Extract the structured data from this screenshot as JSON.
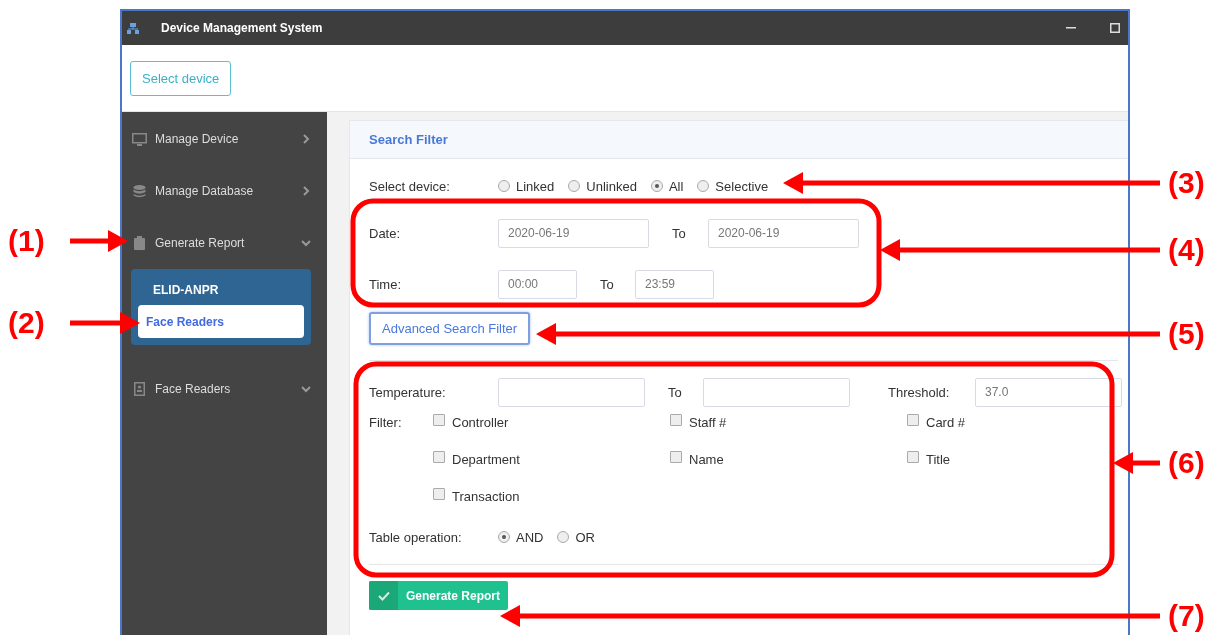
{
  "window": {
    "title": "Device Management System"
  },
  "toolbar": {
    "button": "Select device"
  },
  "sidebar": {
    "items": [
      {
        "label": "Manage Device",
        "expanded": false
      },
      {
        "label": "Manage Database",
        "expanded": false
      },
      {
        "label": "Generate Report",
        "expanded": true,
        "group": {
          "title": "ELID-ANPR",
          "children": [
            {
              "label": "Face Readers",
              "selected": true
            }
          ]
        }
      },
      {
        "label": "Face Readers",
        "expanded": true
      }
    ]
  },
  "search_filter": {
    "title": "Search Filter",
    "device_label": "Select device:",
    "device_options": [
      {
        "label": "Linked",
        "selected": false
      },
      {
        "label": "Unlinked",
        "selected": false
      },
      {
        "label": "All",
        "selected": true
      },
      {
        "label": "Selective",
        "selected": false
      }
    ],
    "date": {
      "label": "Date:",
      "from": "2020-06-19",
      "to_label": "To",
      "to": "2020-06-19"
    },
    "time": {
      "label": "Time:",
      "from": "00:00",
      "to_label": "To",
      "to": "23:59"
    },
    "advanced_button": "Advanced Search Filter",
    "temperature": {
      "label": "Temperature:",
      "to_label": "To"
    },
    "threshold": {
      "label": "Threshold:",
      "value": "37.0"
    },
    "filter_label": "Filter:",
    "filters": [
      {
        "label": "Controller",
        "checked": false
      },
      {
        "label": "Staff #",
        "checked": false
      },
      {
        "label": "Card #",
        "checked": false
      },
      {
        "label": "Department",
        "checked": false
      },
      {
        "label": "Name",
        "checked": false
      },
      {
        "label": "Title",
        "checked": false
      },
      {
        "label": "Transaction",
        "checked": false
      }
    ],
    "table_operation": {
      "label": "Table operation:",
      "options": [
        {
          "label": "AND",
          "selected": true
        },
        {
          "label": "OR",
          "selected": false
        }
      ]
    },
    "submit_button": "Generate Report"
  },
  "annotations": [
    {
      "label": "(1)"
    },
    {
      "label": "(2)"
    },
    {
      "label": "(3)"
    },
    {
      "label": "(4)"
    },
    {
      "label": "(5)"
    },
    {
      "label": "(6)"
    },
    {
      "label": "(7)"
    }
  ]
}
